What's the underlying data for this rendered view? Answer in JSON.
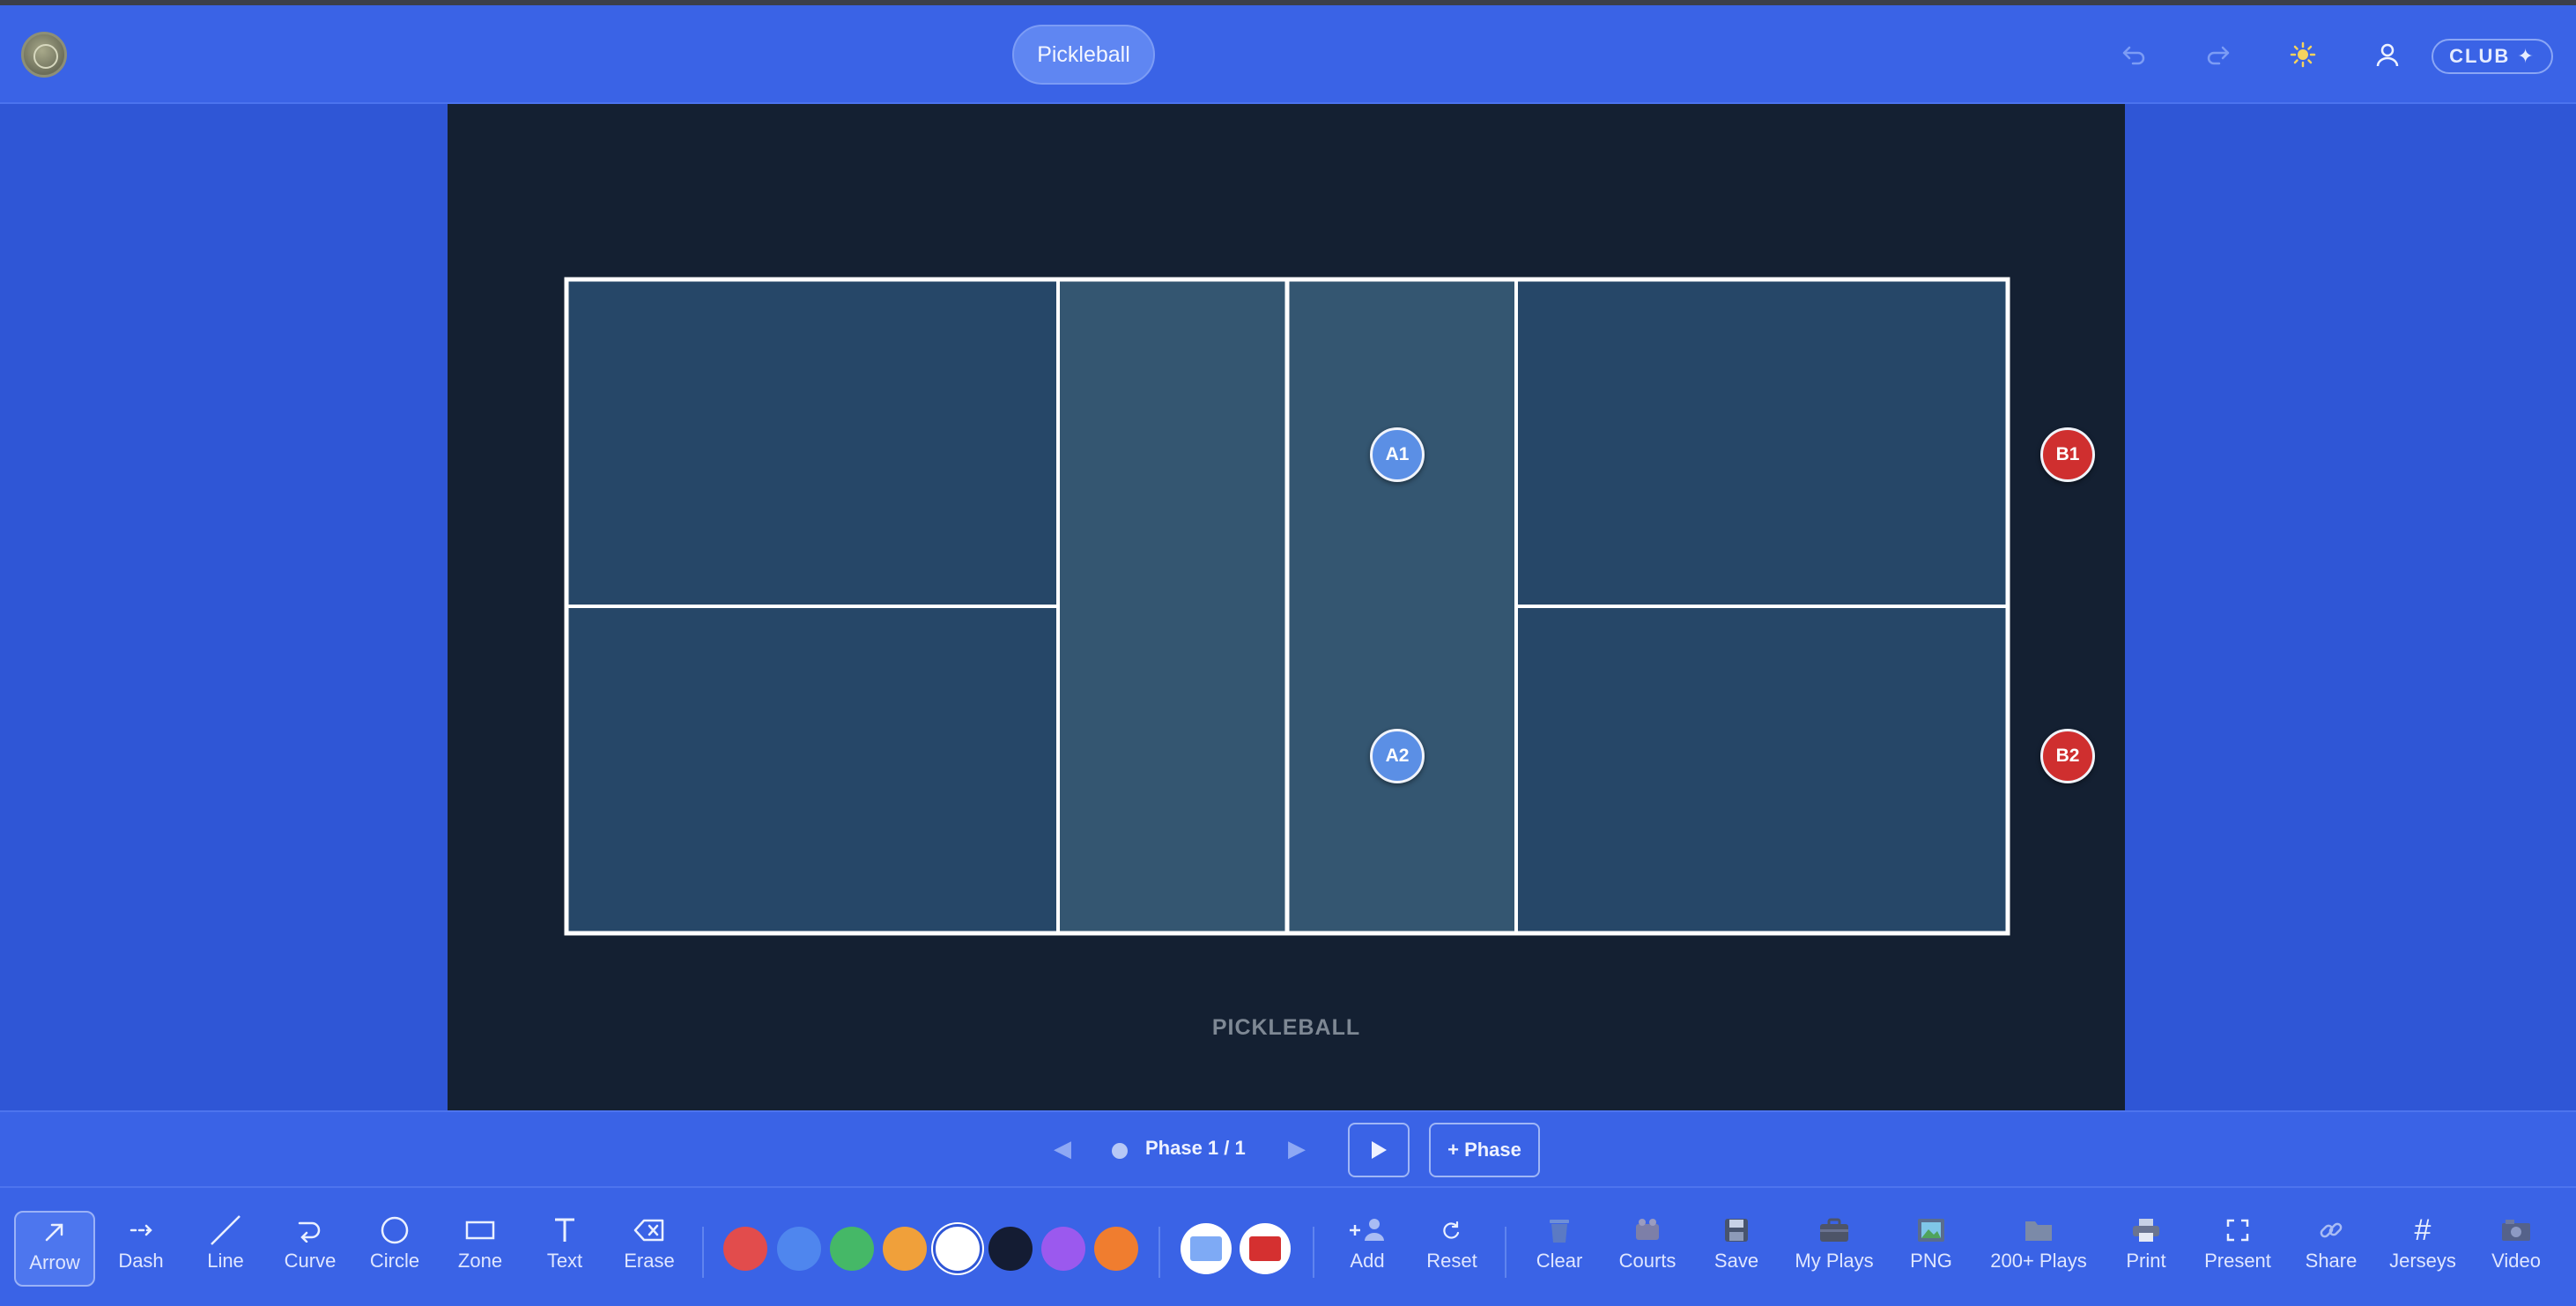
{
  "app": {
    "sport_button": "Pickleball",
    "plan_badge": "CLUB ✦"
  },
  "header_icons": {
    "undo": "undo-icon",
    "redo": "redo-icon",
    "theme": "sun-icon",
    "account": "user-icon"
  },
  "court": {
    "label": "PICKLEBALL",
    "colors": {
      "surface": "#264768",
      "kitchen": "#345671",
      "lines": "#ffffff",
      "background": "#142032"
    }
  },
  "players": [
    {
      "id": "A1",
      "team": "A"
    },
    {
      "id": "A2",
      "team": "A"
    },
    {
      "id": "B1",
      "team": "B"
    },
    {
      "id": "B2",
      "team": "B"
    }
  ],
  "phase": {
    "label": "Phase 1 / 1",
    "add_label": "+ Phase"
  },
  "tools": [
    {
      "label": "Arrow",
      "icon": "arrow-icon",
      "active": true
    },
    {
      "label": "Dash",
      "icon": "dash-arrow-icon"
    },
    {
      "label": "Line",
      "icon": "line-icon"
    },
    {
      "label": "Curve",
      "icon": "curve-icon"
    },
    {
      "label": "Circle",
      "icon": "circle-icon"
    },
    {
      "label": "Zone",
      "icon": "zone-icon"
    },
    {
      "label": "Text",
      "icon": "text-icon"
    },
    {
      "label": "Erase",
      "icon": "erase-icon"
    }
  ],
  "colors": [
    {
      "name": "red",
      "hex": "#e24c4c"
    },
    {
      "name": "blue",
      "hex": "#4f86ee"
    },
    {
      "name": "green",
      "hex": "#45b867"
    },
    {
      "name": "orange-yellow",
      "hex": "#f0a03a"
    },
    {
      "name": "white",
      "hex": "#ffffff",
      "selected": true
    },
    {
      "name": "navy",
      "hex": "#141c33"
    },
    {
      "name": "purple",
      "hex": "#9b59ee"
    },
    {
      "name": "orange",
      "hex": "#f07d2f"
    }
  ],
  "team_colors": {
    "team_a": "#7eaaf5",
    "team_b": "#d53030"
  },
  "actions": [
    {
      "label": "Add",
      "icon": "add-player-icon"
    },
    {
      "label": "Reset",
      "icon": "reset-icon"
    },
    {
      "label": "Clear",
      "icon": "trash-icon"
    },
    {
      "label": "Courts",
      "icon": "courts-icon"
    },
    {
      "label": "Save",
      "icon": "save-icon"
    },
    {
      "label": "My Plays",
      "icon": "briefcase-icon"
    },
    {
      "label": "PNG",
      "icon": "image-icon"
    },
    {
      "label": "200+ Plays",
      "icon": "folder-icon"
    },
    {
      "label": "Print",
      "icon": "printer-icon"
    },
    {
      "label": "Present",
      "icon": "fullscreen-icon"
    },
    {
      "label": "Share",
      "icon": "link-icon"
    },
    {
      "label": "Jerseys",
      "icon": "hash-icon"
    },
    {
      "label": "Video",
      "icon": "video-icon"
    }
  ]
}
